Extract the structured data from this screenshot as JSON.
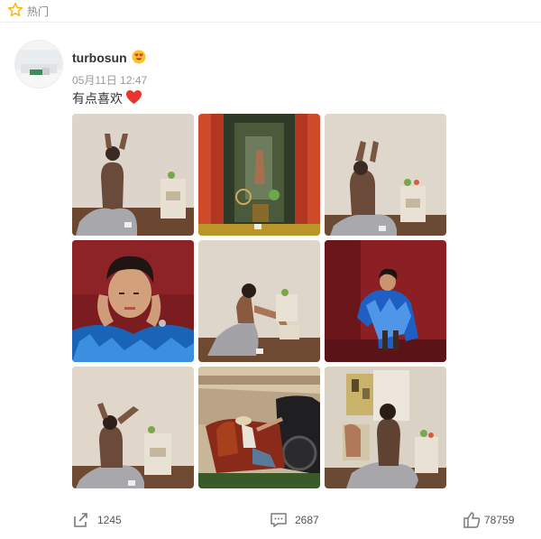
{
  "header": {
    "section_label": "热门"
  },
  "post": {
    "username": "turbosun",
    "timestamp": "05月11日 12:47",
    "text": "有点喜欢"
  },
  "images": [
    {
      "name": "photo-1"
    },
    {
      "name": "photo-2"
    },
    {
      "name": "photo-3"
    },
    {
      "name": "photo-4"
    },
    {
      "name": "photo-5"
    },
    {
      "name": "photo-6"
    },
    {
      "name": "photo-7"
    },
    {
      "name": "photo-8"
    },
    {
      "name": "photo-9"
    }
  ],
  "actions": {
    "repost_count": "1245",
    "comment_count": "2687",
    "like_count": "78759"
  },
  "colors": {
    "star": "#f7b500",
    "heart": "#e8342c",
    "icon_gray": "#7a7a7a"
  }
}
